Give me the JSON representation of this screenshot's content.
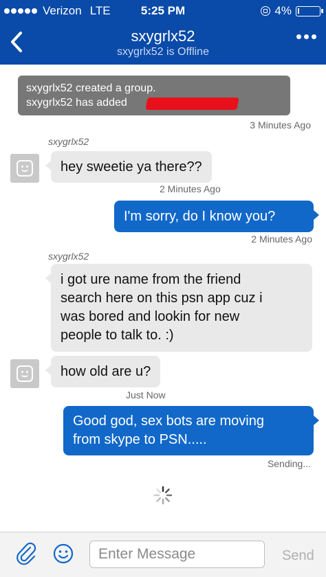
{
  "status_bar": {
    "carrier": "Verizon",
    "network": "LTE",
    "time": "5:25 PM",
    "battery": "4%"
  },
  "header": {
    "back_icon": "chevron-left-icon",
    "title": "sxygrlx52",
    "subtitle": "sxygrlx52 is Offline",
    "more_icon": "ellipsis-icon",
    "bg_color": "#0a4aa8"
  },
  "messages": {
    "system": {
      "line1": "sxygrlx52 created a group.",
      "line2": "sxygrlx52 has added",
      "timestamp": "3 Minutes Ago"
    },
    "m1": {
      "sender": "sxygrlx52",
      "text": "hey sweetie ya there??",
      "timestamp": "2 Minutes Ago"
    },
    "m2": {
      "text": "I'm sorry, do I know you?",
      "timestamp": "2 Minutes Ago"
    },
    "m3": {
      "sender": "sxygrlx52",
      "lines": [
        "i got ure name from the friend",
        "search here on this psn app cuz i",
        "was bored and lookin for new",
        "people to talk to. :)"
      ]
    },
    "m4": {
      "text": "how old are u?",
      "timestamp": "Just Now"
    },
    "m5": {
      "lines": [
        "Good god, sex bots are moving",
        "from skype to PSN....."
      ],
      "status": "Sending..."
    }
  },
  "colors": {
    "outgoing": "#1168c9",
    "incoming": "#e9e9e9",
    "system": "#777777",
    "redaction": "#e8101a"
  },
  "composer": {
    "attach_icon": "paperclip-icon",
    "emoji_icon": "smiley-icon",
    "placeholder": "Enter Message",
    "send_label": "Send"
  }
}
